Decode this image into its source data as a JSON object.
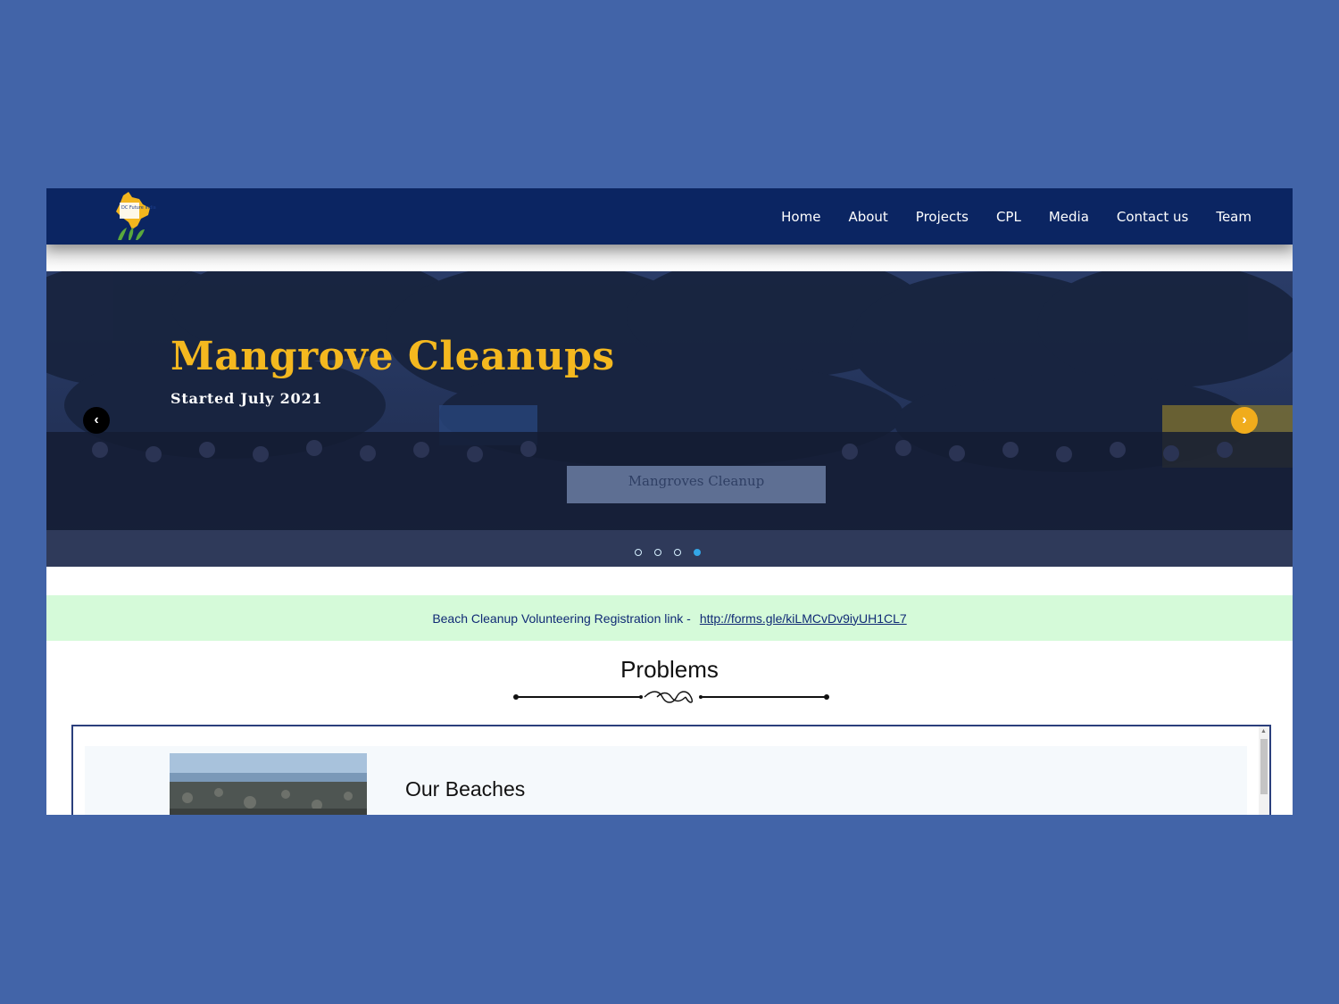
{
  "nav": {
    "logo_text": "DC Future India",
    "items": [
      "Home",
      "About",
      "Projects",
      "CPL",
      "Media",
      "Contact us",
      "Team"
    ]
  },
  "carousel": {
    "title": "Mangrove Cleanups",
    "subtitle": "Started July 2021",
    "banner_text": "Mangroves Cleanup",
    "slide_count": 4,
    "active_index": 3,
    "prev_icon": "chevron-left-icon",
    "next_icon": "chevron-right-icon"
  },
  "announcement": {
    "label": "Beach Cleanup Volunteering Registration link -",
    "link": "http://forms.gle/kiLMCvDv9iyUH1CL7"
  },
  "problems": {
    "title": "Problems",
    "card_title": "Our Beaches"
  },
  "colors": {
    "background": "#4264a8",
    "navbar": "#0b2562",
    "accent": "#f4b81f",
    "announce_bg": "#d5fad9"
  }
}
